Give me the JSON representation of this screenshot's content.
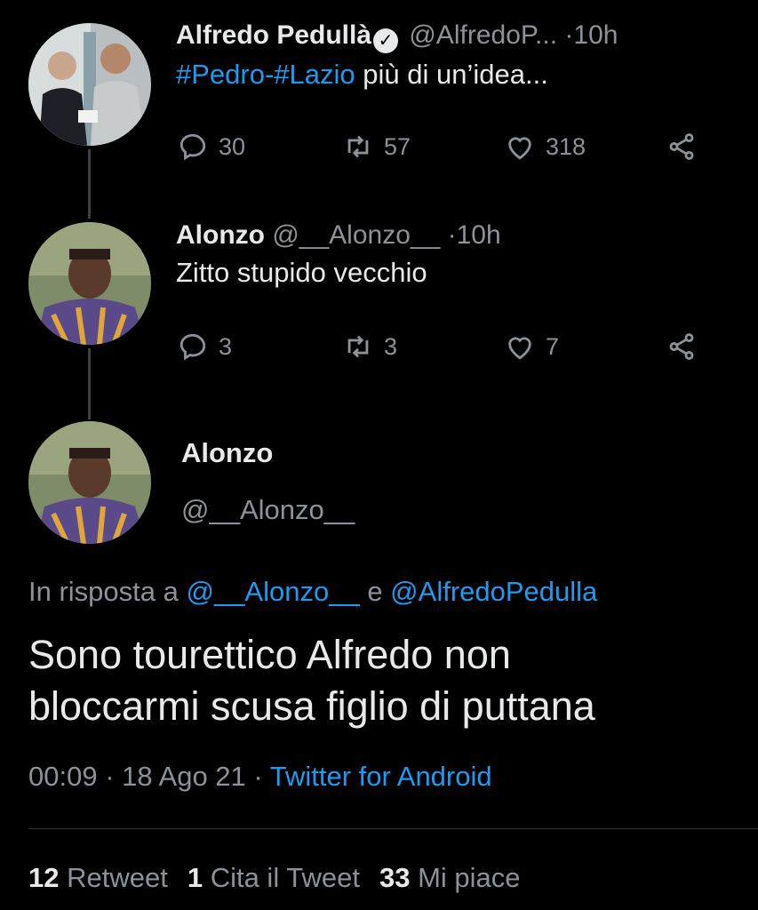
{
  "tweet1": {
    "name": "Alfredo Pedullà",
    "handle": "@AlfredoP...",
    "sep": "·",
    "time": "10h",
    "hashtag1": "#Pedro",
    "dash": "-",
    "hashtag2": "#Lazio",
    "text": " più di un’idea...",
    "replies": "30",
    "retweets": "57",
    "likes": "318"
  },
  "tweet2": {
    "name": "Alonzo",
    "handle": "@__Alonzo__",
    "sep": "·",
    "time": "10h",
    "text": "Zitto stupido vecchio",
    "replies": "3",
    "retweets": "3",
    "likes": "7"
  },
  "main_tweet": {
    "name": "Alonzo",
    "handle": "@__Alonzo__",
    "reply_prefix": "In risposta a ",
    "reply_user1": "@__Alonzo__",
    "reply_and": " e ",
    "reply_user2": "@AlfredoPedulla",
    "text_line1": "Sono tourettico Alfredo non",
    "text_line2": "bloccarmi scusa figlio di puttana",
    "time": "00:09",
    "dot1": " · ",
    "date": "18 Ago 21",
    "dot2": " · ",
    "source": "Twitter for Android"
  },
  "stats": {
    "retweets_count": "12",
    "retweets_label": " Retweet",
    "quotes_count": "1",
    "quotes_label": " Cita il Tweet",
    "likes_count": "33",
    "likes_label": " Mi piace"
  },
  "colors": {
    "background": "#000000",
    "link": "#1d9bf0",
    "muted": "#8b9299",
    "text": "#e7e9ea"
  },
  "icons": [
    "reply-icon",
    "retweet-icon",
    "like-icon",
    "share-icon",
    "verified-icon"
  ]
}
